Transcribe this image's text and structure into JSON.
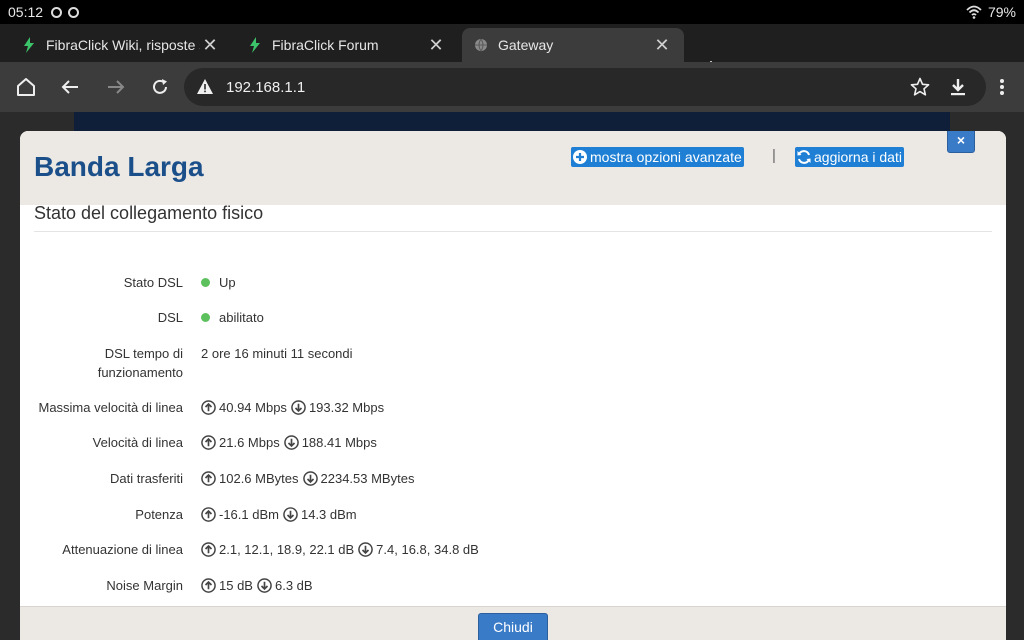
{
  "statusbar": {
    "time": "05:12",
    "battery": "79%"
  },
  "tabs": [
    {
      "title": "FibraClick Wiki, risposte sulla",
      "active": false
    },
    {
      "title": "FibraClick Forum",
      "active": false
    },
    {
      "title": "Gateway",
      "active": true
    }
  ],
  "toolbar": {
    "url": "192.168.1.1"
  },
  "colors": {
    "accent": "#1e7fd4",
    "title_blue": "#1b4f8a",
    "status_green": "#5cc15c"
  },
  "modal": {
    "title": "Banda Larga",
    "advanced_label": "mostra opzioni avanzate",
    "separator": "|",
    "refresh_label": "aggiorna i dati",
    "close_x": "×",
    "section_title": "Stato del collegamento fisico",
    "close_button": "Chiudi",
    "rows": {
      "stato_dsl": {
        "label": "Stato DSL",
        "value": "Up"
      },
      "dsl": {
        "label": "DSL",
        "value": "abilitato"
      },
      "tempo": {
        "label1": "DSL tempo di",
        "label2": "funzionamento",
        "value": "2 ore 16 minuti 11 secondi"
      },
      "max_speed": {
        "label": "Massima velocità di linea",
        "up": "40.94 Mbps",
        "down": "193.32 Mbps"
      },
      "speed": {
        "label": "Velocità di linea",
        "up": "21.6 Mbps",
        "down": "188.41 Mbps"
      },
      "data": {
        "label": "Dati trasferiti",
        "up": "102.6 MBytes",
        "down": "2234.53 MBytes"
      },
      "power": {
        "label": "Potenza",
        "up": "-16.1 dBm",
        "down": "14.3 dBm"
      },
      "attenuation": {
        "label": "Attenuazione di linea",
        "up": "2.1, 12.1, 18.9, 22.1 dB",
        "down": "7.4, 16.8, 34.8 dB"
      },
      "noise": {
        "label": "Noise Margin",
        "up": "15 dB",
        "down": "6.3 dB"
      }
    }
  }
}
